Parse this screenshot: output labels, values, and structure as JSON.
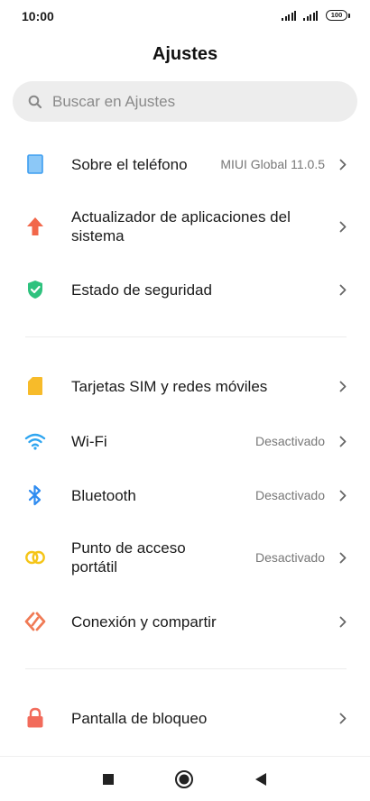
{
  "status_bar": {
    "time": "10:00",
    "battery": "100"
  },
  "header": {
    "title": "Ajustes"
  },
  "search": {
    "placeholder": "Buscar en Ajustes"
  },
  "settings": {
    "about_phone": {
      "label": "Sobre el teléfono",
      "value": "MIUI Global 11.0.5"
    },
    "app_updater": {
      "label_line1": "Actualizador de aplicaciones del",
      "label_line2": "sistema"
    },
    "security_status": {
      "label": "Estado de seguridad"
    },
    "sim_cards": {
      "label": "Tarjetas SIM y redes móviles"
    },
    "wifi": {
      "label": "Wi-Fi",
      "value": "Desactivado"
    },
    "bluetooth": {
      "label": "Bluetooth",
      "value": "Desactivado"
    },
    "hotspot": {
      "label_line1": "Punto de acceso",
      "label_line2": "portátil",
      "value": "Desactivado"
    },
    "connection_sharing": {
      "label": "Conexión y compartir"
    },
    "lock_screen": {
      "label": "Pantalla de bloqueo"
    }
  },
  "icons": {
    "about_phone": "phone-icon",
    "app_updater": "update-arrow-icon",
    "security_status": "shield-check-icon",
    "sim_cards": "sim-card-icon",
    "wifi": "wifi-icon",
    "bluetooth": "bluetooth-icon",
    "hotspot": "hotspot-icon",
    "connection_sharing": "connection-share-icon",
    "lock_screen": "lock-icon"
  },
  "colors": {
    "phone_blue": "#3d9df0",
    "update_orange": "#f2674a",
    "shield_green": "#2ec27e",
    "sim_yellow": "#f7bb2a",
    "wifi_blue": "#2fa5f0",
    "bluetooth_blue": "#2f8cf0",
    "hotspot_yellow": "#f5c518",
    "share_orange": "#f07a55",
    "lock_red": "#f26b5b"
  },
  "nav": {
    "recents": "square-icon",
    "home": "circle-icon",
    "back": "triangle-back-icon"
  }
}
